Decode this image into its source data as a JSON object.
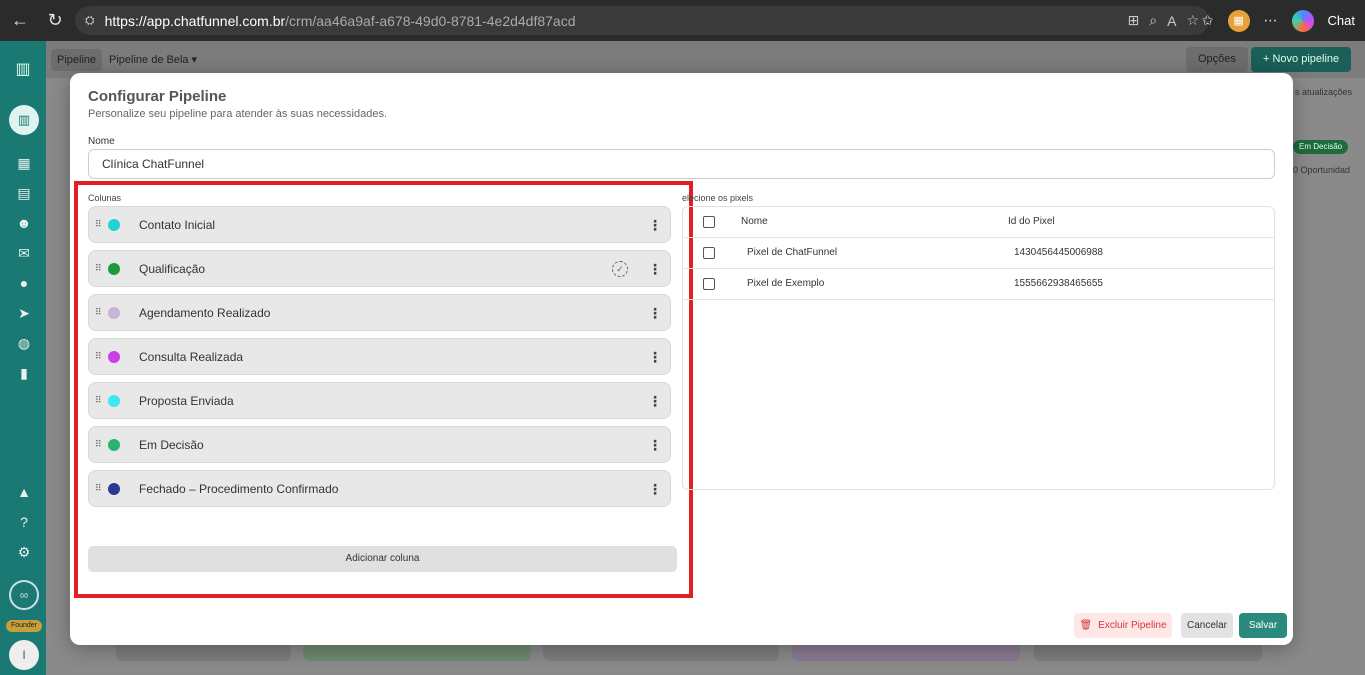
{
  "browser": {
    "url_host": "https://app.chatfunnel.com.br",
    "url_path": "/crm/aa46a9af-a678-49d0-8781-4e2d4df87acd",
    "chat_label": "Chat"
  },
  "background": {
    "tab_pipeline": "Pipeline",
    "tab_pipeline_bela": "Pipeline de Bela ▾",
    "options_button": "Opções",
    "new_pipeline_button": "+ Novo pipeline",
    "updates_snippet": "s atualizações",
    "chip_em_decisao": "Em Decisão",
    "opportunities_snippet": "0 Oportunidad",
    "sidebar_badge": "Founder",
    "avatar_initial": "I"
  },
  "modal": {
    "title": "Configurar Pipeline",
    "subtitle": "Personalize seu pipeline para atender às suas necessidades.",
    "name_label": "Nome",
    "name_value": "Clínica ChatFunnel",
    "columns_label": "Colunas",
    "columns": [
      {
        "name": "Contato Inicial",
        "color": "#22d3d3"
      },
      {
        "name": "Qualificação",
        "color": "#1e9a3a"
      },
      {
        "name": "Agendamento Realizado",
        "color": "#c9b3d9"
      },
      {
        "name": "Consulta Realizada",
        "color": "#c940e6"
      },
      {
        "name": "Proposta Enviada",
        "color": "#3ee8f0"
      },
      {
        "name": "Em Decisão",
        "color": "#27b56e"
      },
      {
        "name": "Fechado – Procedimento Confirmado",
        "color": "#2a3a8f"
      }
    ],
    "add_column_button": "Adicionar coluna",
    "pixels_label": "elecione os pixels",
    "pixels_header": {
      "name": "Nome",
      "id": "Id do Pixel"
    },
    "pixels": [
      {
        "name": "Pixel de ChatFunnel",
        "id": "1430456445006988"
      },
      {
        "name": "Pixel de Exemplo",
        "id": "1555662938465655"
      }
    ],
    "delete_button": "Excluir Pipeline",
    "cancel_button": "Cancelar",
    "save_button": "Salvar"
  },
  "colors": {
    "accent": "#2b8a7e",
    "highlight": "#e31e24",
    "danger": "#d63838"
  }
}
